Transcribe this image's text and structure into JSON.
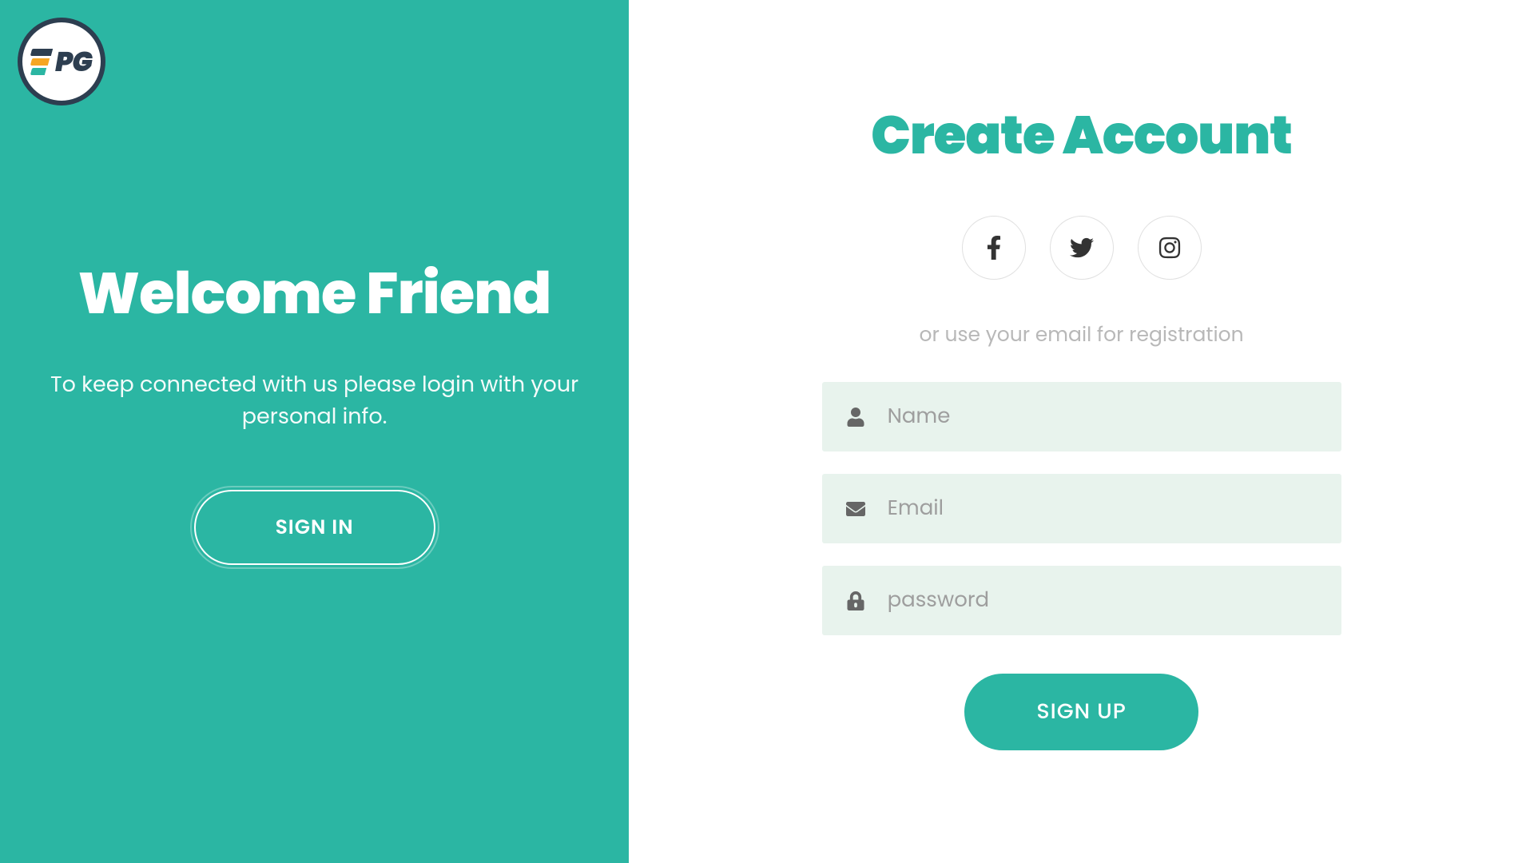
{
  "logo": {
    "text": "PG"
  },
  "left": {
    "title": "Welcome Friend",
    "subtitle": "To keep connected with us please login with your personal info.",
    "signin_label": "SIGN IN"
  },
  "right": {
    "title": "Create Account",
    "or_text": "or use your email for registration",
    "inputs": {
      "name": {
        "placeholder": "Name",
        "value": ""
      },
      "email": {
        "placeholder": "Email",
        "value": ""
      },
      "password": {
        "placeholder": "password",
        "value": ""
      }
    },
    "signup_label": "SIGN UP"
  },
  "colors": {
    "primary": "#2bb6a3",
    "input_bg": "#e8f3ed",
    "text_muted": "#b8b8b8"
  }
}
